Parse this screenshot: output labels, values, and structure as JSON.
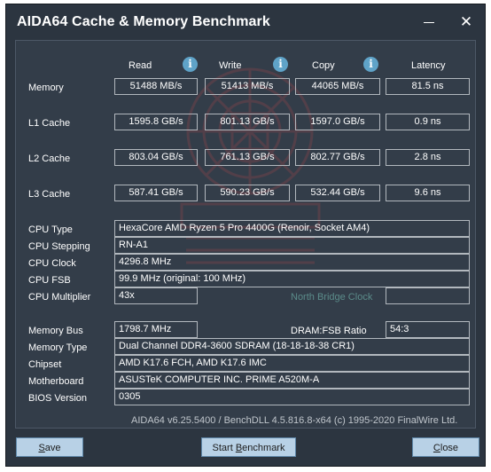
{
  "window": {
    "title": "AIDA64 Cache & Memory Benchmark"
  },
  "icons": {
    "minimize": "minimize-icon",
    "close": "close-icon",
    "info": "info-icon",
    "watermark": "vmodtech-logo"
  },
  "columns": [
    {
      "label": "Read",
      "info_glyph": "i"
    },
    {
      "label": "Write",
      "info_glyph": "i"
    },
    {
      "label": "Copy",
      "info_glyph": "i"
    },
    {
      "label": "Latency"
    }
  ],
  "bench_rows": [
    {
      "label": "Memory",
      "read": "51488 MB/s",
      "write": "51413 MB/s",
      "copy": "44065 MB/s",
      "latency": "81.5 ns"
    },
    {
      "label": "L1 Cache",
      "read": "1595.8 GB/s",
      "write": "801.13 GB/s",
      "copy": "1597.0 GB/s",
      "latency": "0.9 ns"
    },
    {
      "label": "L2 Cache",
      "read": "803.04 GB/s",
      "write": "761.13 GB/s",
      "copy": "802.77 GB/s",
      "latency": "2.8 ns"
    },
    {
      "label": "L3 Cache",
      "read": "587.41 GB/s",
      "write": "590.23 GB/s",
      "copy": "532.44 GB/s",
      "latency": "9.6 ns"
    }
  ],
  "cpu": {
    "type_label": "CPU Type",
    "type": "HexaCore AMD Ryzen 5 Pro 4400G  (Renoir, Socket AM4)",
    "stepping_label": "CPU Stepping",
    "stepping": "RN-A1",
    "clock_label": "CPU Clock",
    "clock": "4296.8 MHz",
    "fsb_label": "CPU FSB",
    "fsb": "99.9 MHz  (original: 100 MHz)",
    "multiplier_label": "CPU Multiplier",
    "multiplier": "43x",
    "nb_clock_label": "North Bridge Clock",
    "nb_clock": ""
  },
  "memory": {
    "bus_label": "Memory Bus",
    "bus": "1798.7 MHz",
    "ratio_label": "DRAM:FSB Ratio",
    "ratio": "54:3",
    "type_label": "Memory Type",
    "type": "Dual Channel DDR4-3600 SDRAM  (18-18-18-38 CR1)",
    "chipset_label": "Chipset",
    "chipset": "AMD K17.6 FCH, AMD K17.6 IMC",
    "motherboard_label": "Motherboard",
    "motherboard": "ASUSTeK COMPUTER INC. PRIME A520M-A",
    "bios_label": "BIOS Version",
    "bios": "0305"
  },
  "footer": "AIDA64 v6.25.5400 / BenchDLL 4.5.816.8-x64  (c) 1995-2020 FinalWire Ltd.",
  "buttons": {
    "save_accel": "S",
    "save_rest": "ave",
    "start_pre": "Start ",
    "start_accel": "B",
    "start_rest": "enchmark",
    "close_accel": "C",
    "close_rest": "lose"
  }
}
